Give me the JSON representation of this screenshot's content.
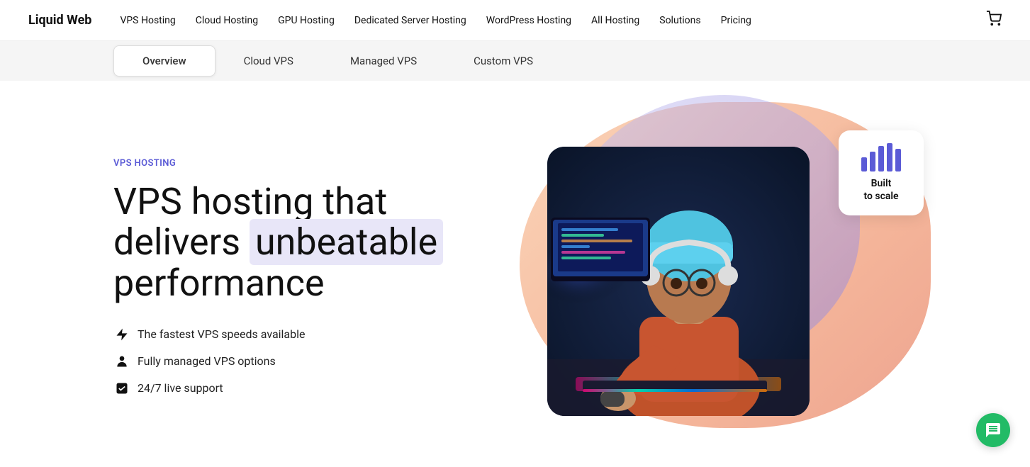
{
  "brand": {
    "logo": "Liquid Web"
  },
  "nav": {
    "links": [
      {
        "label": "VPS Hosting",
        "id": "vps-hosting"
      },
      {
        "label": "Cloud Hosting",
        "id": "cloud-hosting"
      },
      {
        "label": "GPU Hosting",
        "id": "gpu-hosting"
      },
      {
        "label": "Dedicated Server Hosting",
        "id": "dedicated-server"
      },
      {
        "label": "WordPress Hosting",
        "id": "wordpress-hosting"
      },
      {
        "label": "All Hosting",
        "id": "all-hosting"
      },
      {
        "label": "Solutions",
        "id": "solutions"
      },
      {
        "label": "Pricing",
        "id": "pricing"
      }
    ],
    "cart_icon": "🛒"
  },
  "sub_nav": {
    "items": [
      {
        "label": "Overview",
        "active": true
      },
      {
        "label": "Cloud VPS",
        "active": false
      },
      {
        "label": "Managed VPS",
        "active": false
      },
      {
        "label": "Custom VPS",
        "active": false
      }
    ]
  },
  "hero": {
    "badge": "VPS hosting",
    "title_before": "VPS hosting that delivers ",
    "title_highlight": "unbeatable",
    "title_after": " performance",
    "features": [
      {
        "icon": "bolt",
        "text": "The fastest VPS speeds available"
      },
      {
        "icon": "person",
        "text": "Fully managed VPS options"
      },
      {
        "icon": "check",
        "text": "24/7 live support"
      }
    ],
    "built_card": {
      "label": "Built\nto scale"
    },
    "bars": [
      20,
      28,
      36,
      40,
      32
    ]
  }
}
